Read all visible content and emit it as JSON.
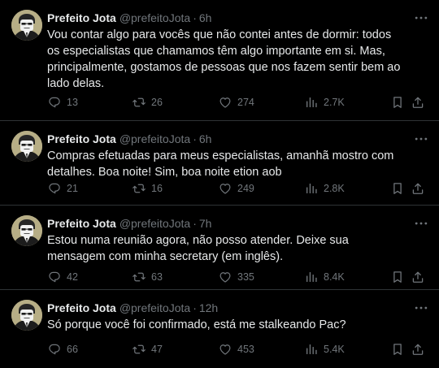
{
  "tweets": [
    {
      "name": "Prefeito Jota",
      "handle": "@prefeitoJota",
      "dot": "·",
      "time": "6h",
      "text": "Vou contar algo para vocês que não contei antes de dormir: todos os especialistas que chamamos têm algo importante em si. Mas, principalmente, gostamos de pessoas que nos fazem sentir bem ao lado delas.",
      "replies": "13",
      "retweets": "26",
      "likes": "274",
      "views": "2.7K"
    },
    {
      "name": "Prefeito Jota",
      "handle": "@prefeitoJota",
      "dot": "·",
      "time": "6h",
      "text": "Compras efetuadas para meus especialistas, amanhã mostro com detalhes. Boa noite! Sim, boa noite etion aob",
      "replies": "21",
      "retweets": "16",
      "likes": "249",
      "views": "2.8K"
    },
    {
      "name": "Prefeito Jota",
      "handle": "@prefeitoJota",
      "dot": "·",
      "time": "7h",
      "text": "Estou numa reunião agora, não posso atender. Deixe sua mensagem com minha secretary (em inglês).",
      "replies": "42",
      "retweets": "63",
      "likes": "335",
      "views": "8.4K"
    },
    {
      "name": "Prefeito Jota",
      "handle": "@prefeitoJota",
      "dot": "·",
      "time": "12h",
      "text": "Só porque você foi confirmado, está me stalkeando Pac?",
      "replies": "66",
      "retweets": "47",
      "likes": "453",
      "views": "5.4K"
    }
  ],
  "icons": {
    "more": "more-horizontal-icon",
    "reply": "reply-bubble-icon",
    "retweet": "retweet-icon",
    "like": "heart-icon",
    "views": "views-bar-chart-icon",
    "bookmark": "bookmark-icon",
    "share": "share-upload-icon"
  },
  "colors": {
    "background": "#000000",
    "text": "#e7e9ea",
    "muted": "#71767b",
    "divider": "#2f3336"
  }
}
